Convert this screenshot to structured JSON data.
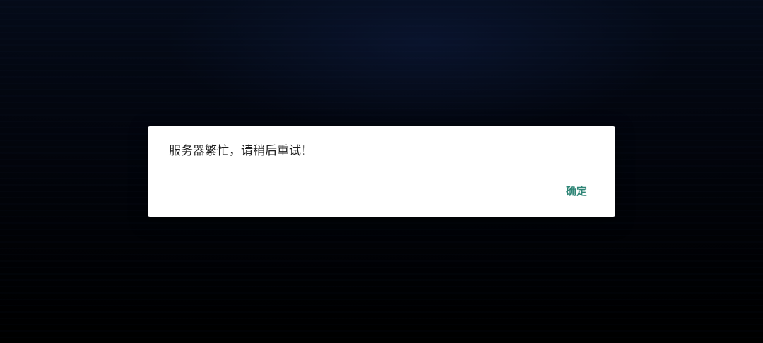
{
  "dialog": {
    "message": "服务器繁忙，请稍后重试！",
    "confirm_label": "确定"
  },
  "colors": {
    "accent": "#2e8576",
    "dialog_bg": "#ffffff",
    "backdrop": "#050a18"
  }
}
